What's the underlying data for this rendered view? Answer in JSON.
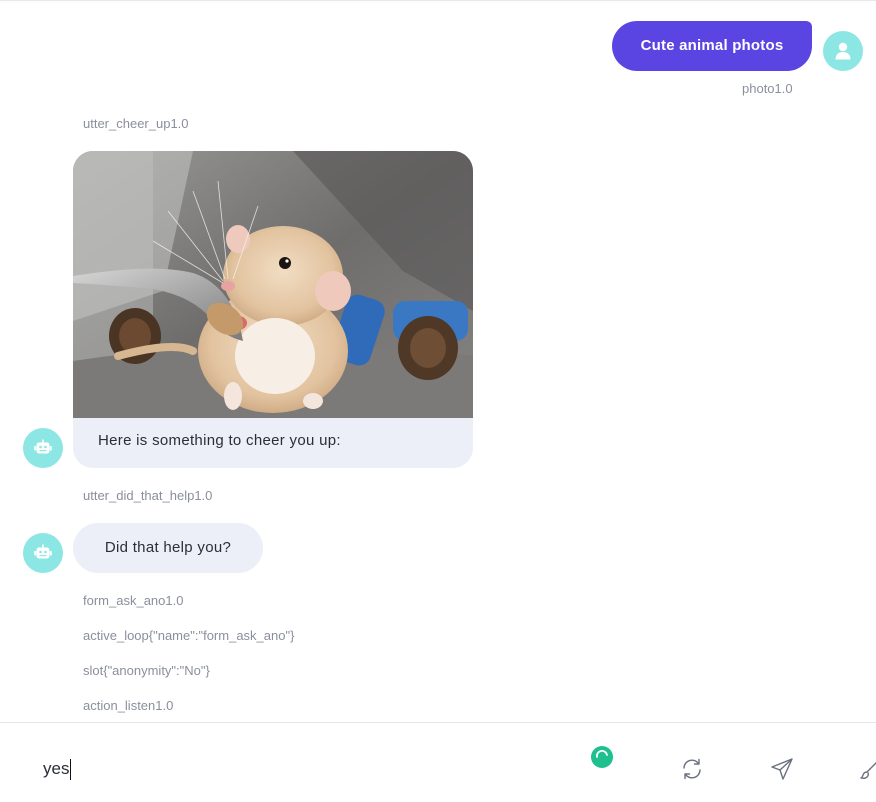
{
  "conversation": {
    "user_message": {
      "text": "Cute animal photos",
      "meta": "photo1.0"
    },
    "bot_image_message": {
      "meta": "utter_cheer_up1.0",
      "caption": "Here is something to cheer you up:"
    },
    "bot_text_message": {
      "meta": "utter_did_that_help1.0",
      "text": "Did that help you?"
    },
    "trailing_meta": [
      "form_ask_ano1.0",
      "active_loop{\"name\":\"form_ask_ano\"}",
      "slot{\"anonymity\":\"No\"}",
      "action_listen1.0"
    ]
  },
  "input": {
    "value": "yes"
  },
  "icons": {
    "user_avatar": "user-icon",
    "bot_avatar": "robot-icon",
    "status": "loading-spinner-icon",
    "restart": "refresh-icon",
    "send": "send-icon",
    "extra": "brush-icon"
  },
  "colors": {
    "user_bubble": "#5a45e2",
    "avatar_bg": "#8ce6e3",
    "bot_bubble": "#eceff7",
    "spinner": "#1fc08e",
    "meta_text": "#8a8f9c"
  }
}
